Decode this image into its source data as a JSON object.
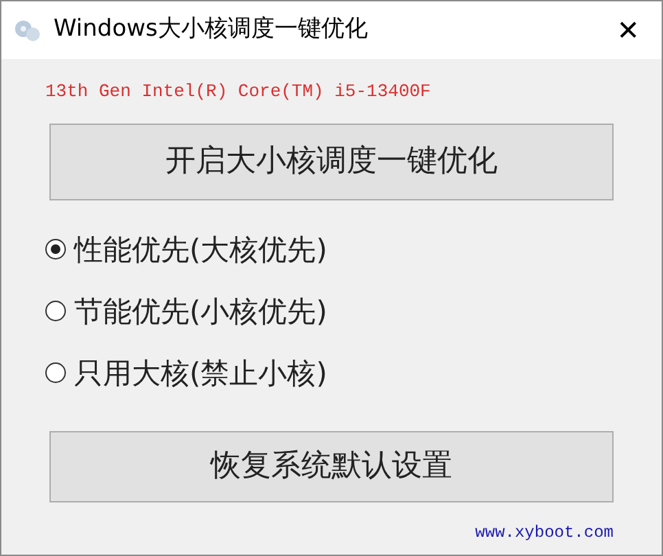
{
  "window": {
    "title": "Windows大小核调度一键优化",
    "close": "✕"
  },
  "cpu": "13th Gen Intel(R) Core(TM) i5-13400F",
  "optimize_button": "开启大小核调度一键优化",
  "modes": [
    {
      "label": "性能优先(大核优先)",
      "selected": true
    },
    {
      "label": "节能优先(小核优先)",
      "selected": false
    },
    {
      "label": "只用大核(禁止小核)",
      "selected": false
    }
  ],
  "restore_button": "恢复系统默认设置",
  "link": "www.xyboot.com"
}
